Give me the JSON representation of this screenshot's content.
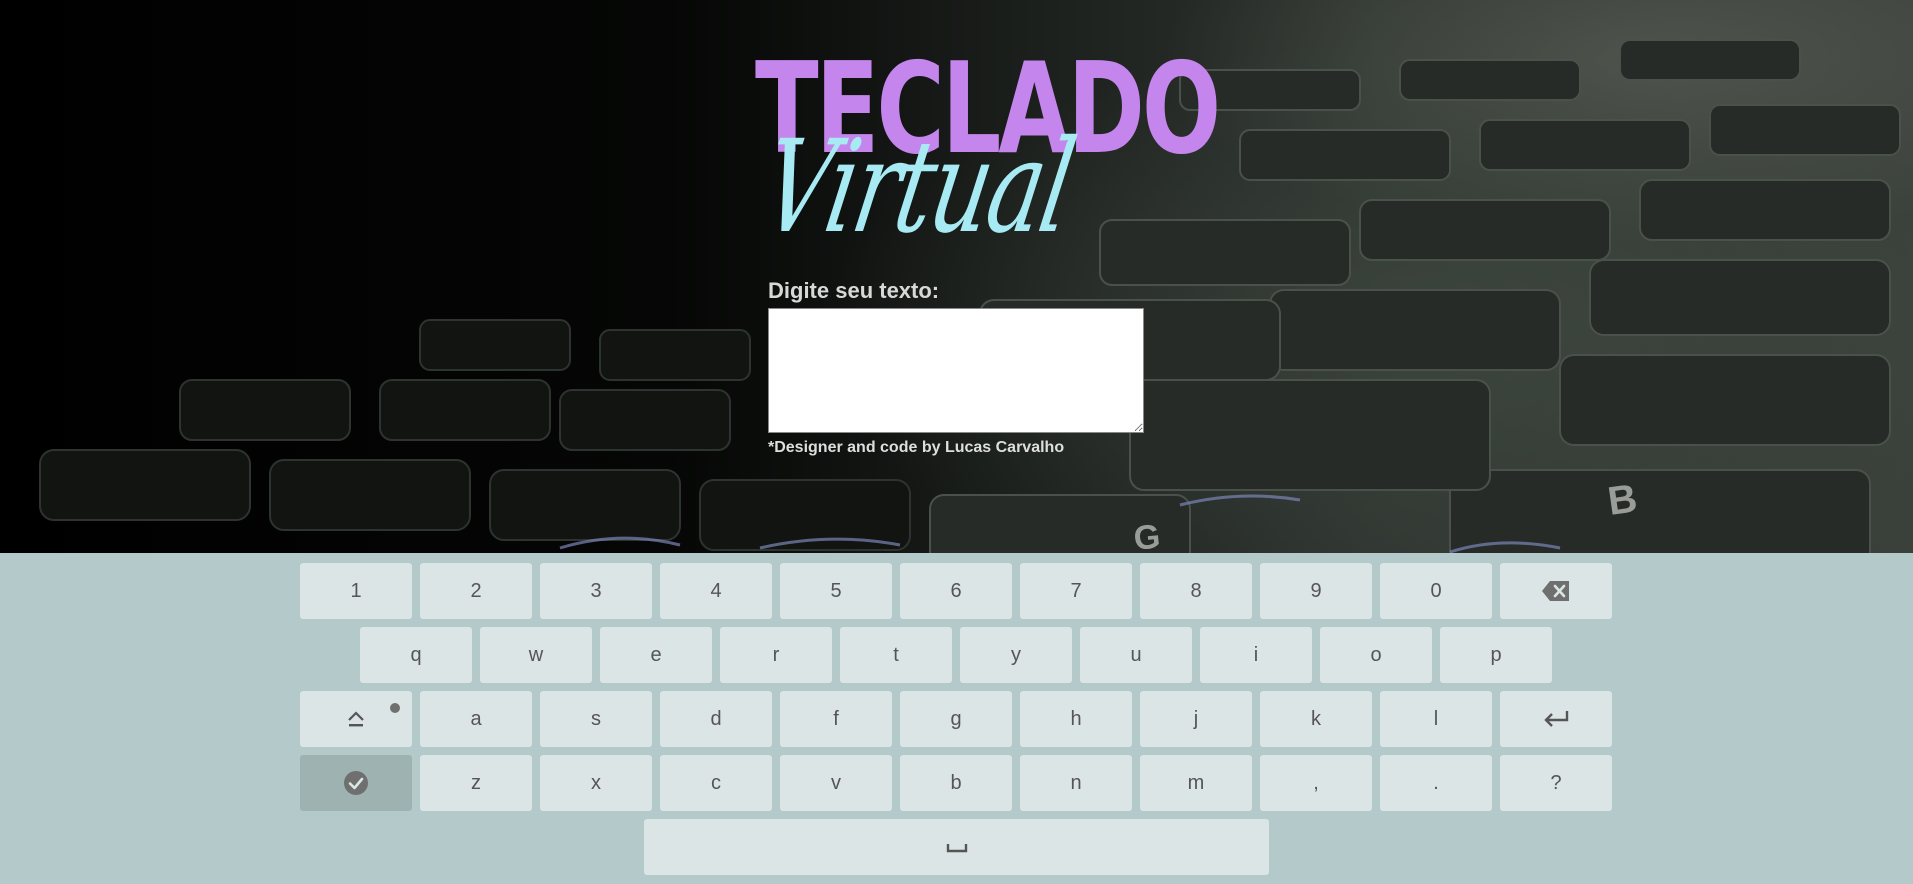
{
  "hero": {
    "logo_main": "TECLADO",
    "logo_script": "Virtual"
  },
  "form": {
    "label": "Digite seu texto:",
    "textarea_value": "",
    "credit": "*Designer and code by Lucas Carvalho"
  },
  "keyboard": {
    "row1": [
      "1",
      "2",
      "3",
      "4",
      "5",
      "6",
      "7",
      "8",
      "9",
      "0"
    ],
    "row2": [
      "q",
      "w",
      "e",
      "r",
      "t",
      "y",
      "u",
      "i",
      "o",
      "p"
    ],
    "row3": [
      "a",
      "s",
      "d",
      "f",
      "g",
      "h",
      "j",
      "k",
      "l"
    ],
    "row4": [
      "z",
      "x",
      "c",
      "v",
      "b",
      "n",
      "m",
      ",",
      ".",
      "?"
    ],
    "icons": {
      "backspace": "backspace-icon",
      "shift": "shift-icon",
      "enter": "enter-icon",
      "done": "check-circle-icon",
      "space": "space-icon"
    }
  },
  "colors": {
    "logo_main": "#c486ec",
    "logo_script": "#a8eaf3",
    "keyboard_bg": "#b4c9c9",
    "key_bg": "#dbe5e5",
    "key_dark_bg": "#9fb2b2",
    "key_text": "#555555"
  }
}
